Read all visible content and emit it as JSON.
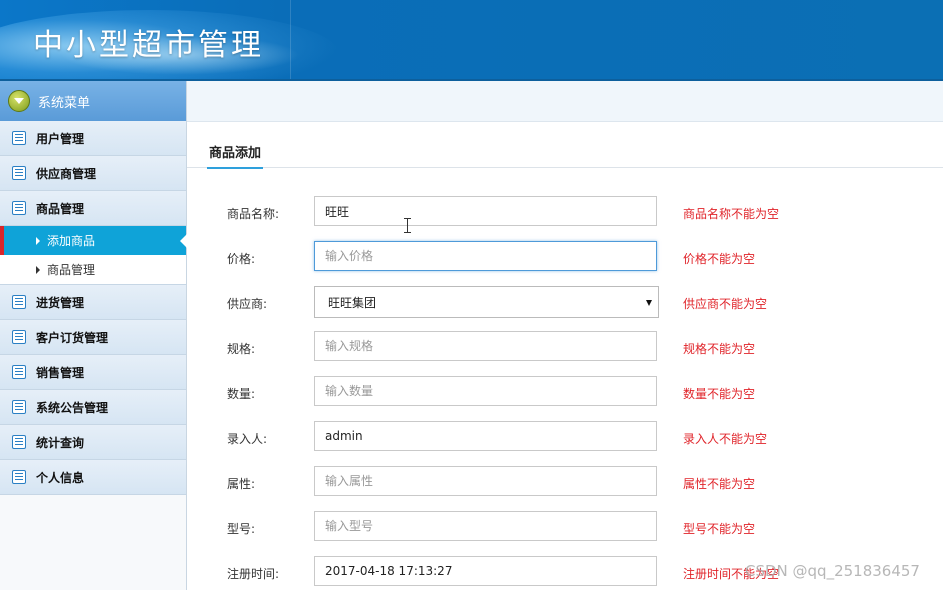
{
  "app": {
    "title": "中小型超市管理"
  },
  "sidebar": {
    "header": "系统菜单",
    "menus": [
      {
        "label": "用户管理"
      },
      {
        "label": "供应商管理"
      },
      {
        "label": "商品管理",
        "sub": [
          {
            "label": "添加商品",
            "active": true
          },
          {
            "label": "商品管理",
            "active": false
          }
        ]
      },
      {
        "label": "进货管理"
      },
      {
        "label": "客户订货管理"
      },
      {
        "label": "销售管理"
      },
      {
        "label": "系统公告管理"
      },
      {
        "label": "统计查询"
      },
      {
        "label": "个人信息"
      }
    ]
  },
  "main": {
    "tab": "商品添加",
    "form": {
      "name": {
        "label": "商品名称:",
        "value": "旺旺",
        "placeholder": "",
        "error": "商品名称不能为空"
      },
      "price": {
        "label": "价格:",
        "value": "",
        "placeholder": "输入价格",
        "error": "价格不能为空"
      },
      "supplier": {
        "label": "供应商:",
        "value": "旺旺集团",
        "error": "供应商不能为空"
      },
      "spec": {
        "label": "规格:",
        "value": "",
        "placeholder": "输入规格",
        "error": "规格不能为空"
      },
      "qty": {
        "label": "数量:",
        "value": "",
        "placeholder": "输入数量",
        "error": "数量不能为空"
      },
      "entry": {
        "label": "录入人:",
        "value": "admin",
        "placeholder": "",
        "error": "录入人不能为空"
      },
      "attr": {
        "label": "属性:",
        "value": "",
        "placeholder": "输入属性",
        "error": "属性不能为空"
      },
      "model": {
        "label": "型号:",
        "value": "",
        "placeholder": "输入型号",
        "error": "型号不能为空"
      },
      "regtime": {
        "label": "注册时间:",
        "value": "2017-04-18 17:13:27",
        "placeholder": "",
        "error": "注册时间不能为空"
      }
    }
  },
  "watermark": "CSDN @qq_251836457"
}
